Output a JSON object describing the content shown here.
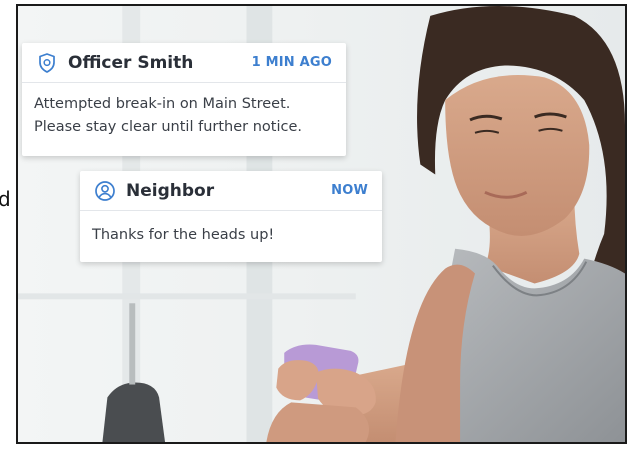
{
  "stray_edge_text": "d",
  "notifications": [
    {
      "icon": "shield-icon",
      "sender": "Officer Smith",
      "time": "1 MIN AGO",
      "message_lines": [
        "Attempted break-in on Main Street.",
        "Please stay clear until further notice."
      ]
    },
    {
      "icon": "user-circle-icon",
      "sender": "Neighbor",
      "time": "NOW",
      "message_lines": [
        "Thanks for the heads up!"
      ]
    }
  ],
  "colors": {
    "accent": "#3d7fcf",
    "text_dark": "#2a2f38",
    "text_body": "#3a3f47",
    "card_bg": "#ffffff",
    "phone": "#b89ad6"
  }
}
